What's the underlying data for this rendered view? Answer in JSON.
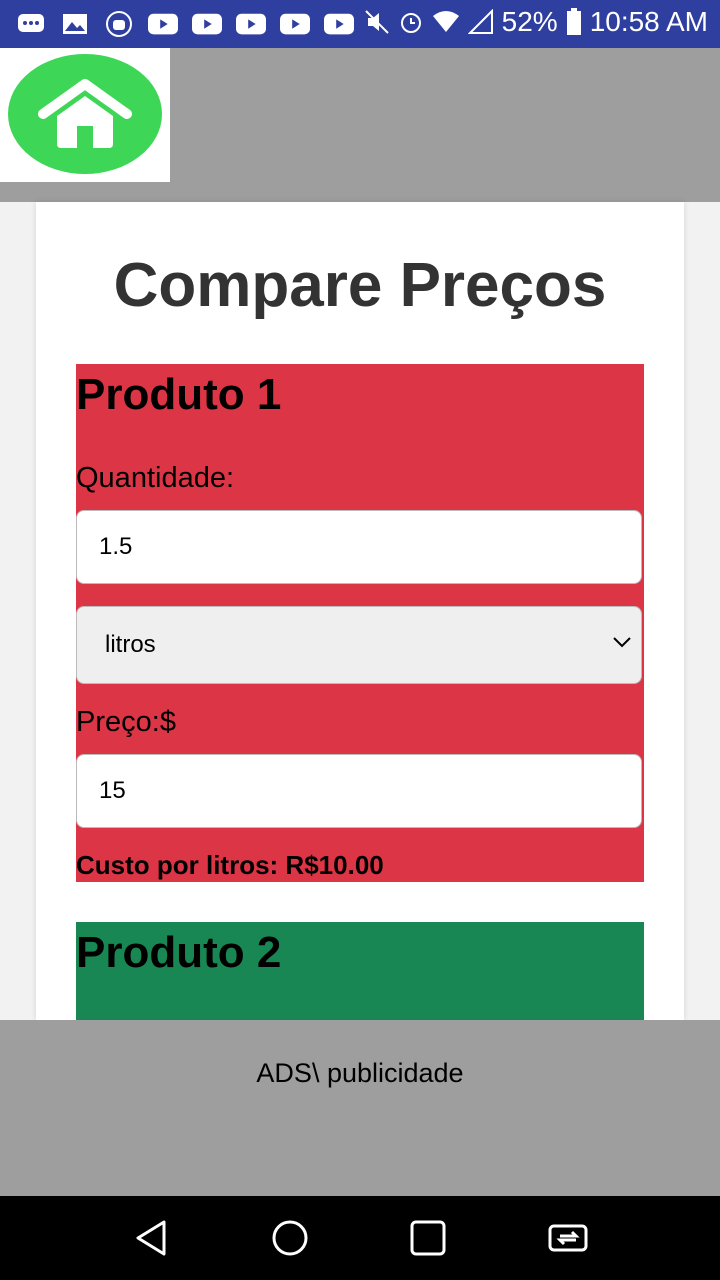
{
  "status_bar": {
    "battery": "52%",
    "time": "10:58 AM",
    "left_icons": [
      "chat-icon",
      "image-icon",
      "android-icon",
      "youtube-icon",
      "youtube-icon",
      "youtube-icon",
      "youtube-icon",
      "youtube-icon"
    ],
    "right_icons": [
      "mute-icon",
      "alarm-icon",
      "wifi-icon",
      "signal-icon",
      "battery-icon"
    ]
  },
  "header": {
    "home_icon": "home-icon",
    "accent_color": "#3dd656"
  },
  "main": {
    "title": "Compare Preços",
    "product1": {
      "title": "Produto 1",
      "quantity_label": "Quantidade:",
      "quantity_value": "1.5",
      "unit_selected": "litros",
      "price_label": "Preço:$",
      "price_value": "15",
      "result": "Custo por litros: R$10.00",
      "color": "#dc3545"
    },
    "product2": {
      "title": "Produto 2",
      "color": "#198754"
    }
  },
  "ads": {
    "text": "ADS\\ publicidade"
  },
  "navbar": {
    "icons": [
      "back-icon",
      "home-circle-icon",
      "recents-icon",
      "screen-mirror-icon"
    ]
  }
}
